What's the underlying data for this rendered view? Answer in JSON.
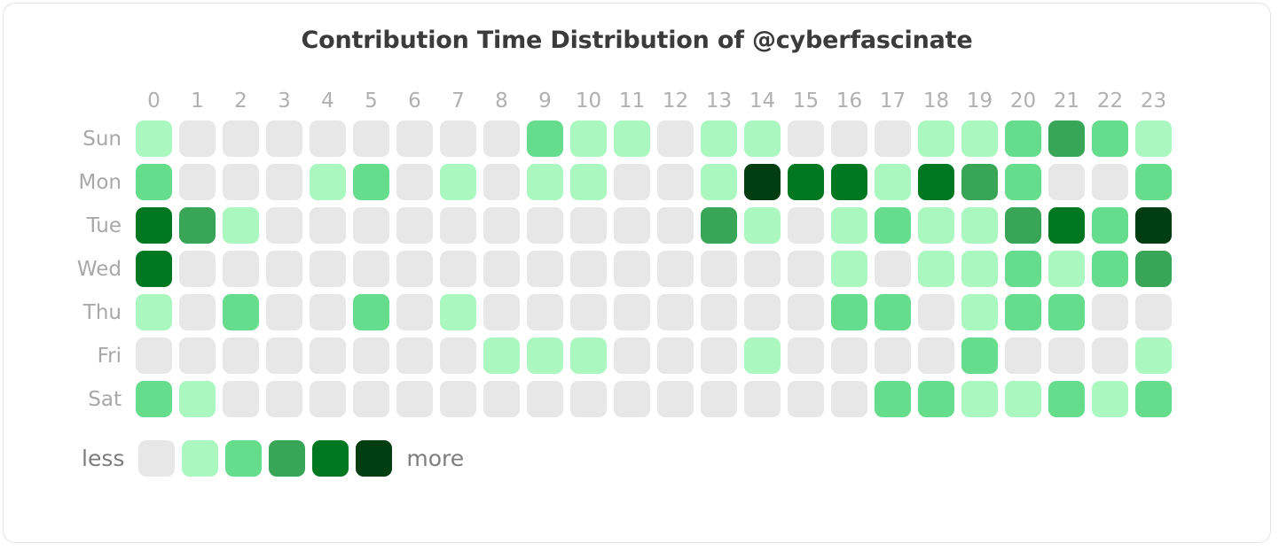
{
  "title": "Contribution Time Distribution of @cyberfascinate",
  "legend": {
    "less_label": "less",
    "more_label": "more",
    "levels": [
      0,
      1,
      2,
      3,
      4,
      5
    ]
  },
  "palette": {
    "level0": "#e7e7e7",
    "level1": "#aaf7c0",
    "level2": "#66dd8c",
    "level3": "#38a557",
    "level4": "#007822",
    "level5": "#003d11"
  },
  "chart_data": {
    "type": "heatmap",
    "title": "Contribution Time Distribution of @cyberfascinate",
    "xlabel": "",
    "ylabel": "",
    "grid": false,
    "legend_position": "bottom-left",
    "x_tick_labels": [
      "0",
      "1",
      "2",
      "3",
      "4",
      "5",
      "6",
      "7",
      "8",
      "9",
      "10",
      "11",
      "12",
      "13",
      "14",
      "15",
      "16",
      "17",
      "18",
      "19",
      "20",
      "21",
      "22",
      "23"
    ],
    "y_tick_labels": [
      "Sun",
      "Mon",
      "Tue",
      "Wed",
      "Thu",
      "Fri",
      "Sat"
    ],
    "value_range": [
      0,
      5
    ],
    "rows": [
      {
        "day": "Sun",
        "values": [
          1,
          0,
          0,
          0,
          0,
          0,
          0,
          0,
          0,
          2,
          1,
          1,
          0,
          1,
          1,
          0,
          0,
          0,
          1,
          1,
          2,
          3,
          2,
          1
        ]
      },
      {
        "day": "Mon",
        "values": [
          2,
          0,
          0,
          0,
          1,
          2,
          0,
          1,
          0,
          1,
          1,
          0,
          0,
          1,
          5,
          4,
          4,
          1,
          4,
          3,
          2,
          0,
          0,
          2
        ]
      },
      {
        "day": "Tue",
        "values": [
          4,
          3,
          1,
          0,
          0,
          0,
          0,
          0,
          0,
          0,
          0,
          0,
          0,
          3,
          1,
          0,
          1,
          2,
          1,
          1,
          3,
          4,
          2,
          5
        ]
      },
      {
        "day": "Wed",
        "values": [
          4,
          0,
          0,
          0,
          0,
          0,
          0,
          0,
          0,
          0,
          0,
          0,
          0,
          0,
          0,
          0,
          1,
          0,
          1,
          1,
          2,
          1,
          2,
          3
        ]
      },
      {
        "day": "Thu",
        "values": [
          1,
          0,
          2,
          0,
          0,
          2,
          0,
          1,
          0,
          0,
          0,
          0,
          0,
          0,
          0,
          0,
          2,
          2,
          0,
          1,
          2,
          2,
          0,
          0
        ]
      },
      {
        "day": "Fri",
        "values": [
          0,
          0,
          0,
          0,
          0,
          0,
          0,
          0,
          1,
          1,
          1,
          0,
          0,
          0,
          1,
          0,
          0,
          0,
          0,
          2,
          0,
          0,
          0,
          1
        ]
      },
      {
        "day": "Sat",
        "values": [
          2,
          1,
          0,
          0,
          0,
          0,
          0,
          0,
          0,
          0,
          0,
          0,
          0,
          0,
          0,
          0,
          0,
          2,
          2,
          1,
          1,
          2,
          1,
          2
        ]
      }
    ]
  }
}
